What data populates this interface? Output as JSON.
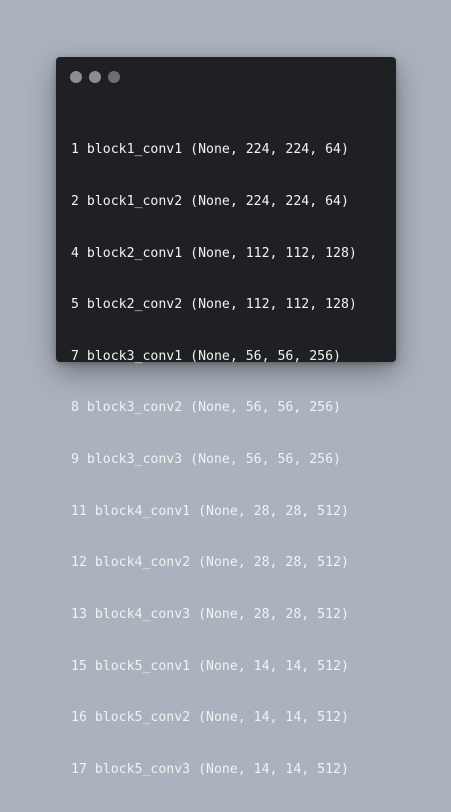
{
  "window": {
    "controls": [
      "dot",
      "dot",
      "dot"
    ]
  },
  "layers": [
    {
      "num": "1",
      "name": "block1_conv1",
      "shape": "(None, 224, 224, 64)"
    },
    {
      "num": "2",
      "name": "block1_conv2",
      "shape": "(None, 224, 224, 64)"
    },
    {
      "num": "4",
      "name": "block2_conv1",
      "shape": "(None, 112, 112, 128)"
    },
    {
      "num": "5",
      "name": "block2_conv2",
      "shape": "(None, 112, 112, 128)"
    },
    {
      "num": "7",
      "name": "block3_conv1",
      "shape": "(None, 56, 56, 256)"
    },
    {
      "num": "8",
      "name": "block3_conv2",
      "shape": "(None, 56, 56, 256)"
    },
    {
      "num": "9",
      "name": "block3_conv3",
      "shape": "(None, 56, 56, 256)"
    },
    {
      "num": "11",
      "name": "block4_conv1",
      "shape": "(None, 28, 28, 512)"
    },
    {
      "num": "12",
      "name": "block4_conv2",
      "shape": "(None, 28, 28, 512)"
    },
    {
      "num": "13",
      "name": "block4_conv3",
      "shape": "(None, 28, 28, 512)"
    },
    {
      "num": "15",
      "name": "block5_conv1",
      "shape": "(None, 14, 14, 512)"
    },
    {
      "num": "16",
      "name": "block5_conv2",
      "shape": "(None, 14, 14, 512)"
    },
    {
      "num": "17",
      "name": "block5_conv3",
      "shape": "(None, 14, 14, 512)"
    }
  ],
  "colors": {
    "background": "#aab2bd",
    "window": "#1f2024",
    "text": "#f2f2f2",
    "dot": "#8e8e8e"
  }
}
